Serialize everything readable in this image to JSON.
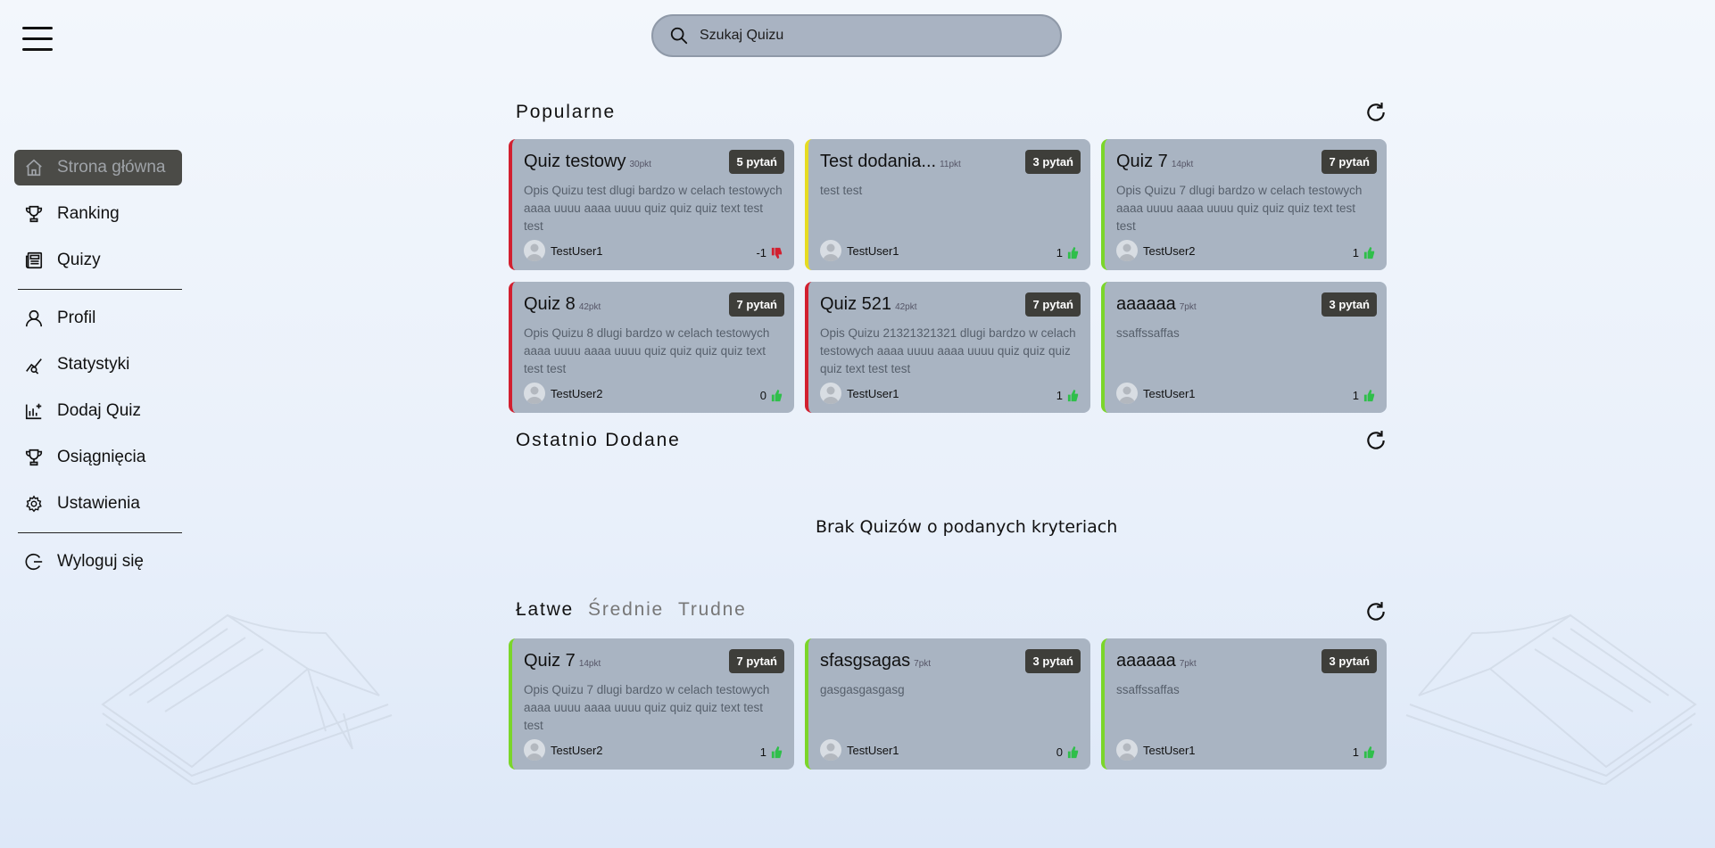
{
  "search": {
    "placeholder": "Szukaj Quizu"
  },
  "sidebar": {
    "items": [
      {
        "label": "Strona główna",
        "icon": "home-icon",
        "active": true
      },
      {
        "label": "Ranking",
        "icon": "trophy-icon"
      },
      {
        "label": "Quizy",
        "icon": "newspaper-icon"
      },
      {
        "label": "Profil",
        "icon": "user-icon"
      },
      {
        "label": "Statystyki",
        "icon": "chart-line-icon"
      },
      {
        "label": "Dodaj Quiz",
        "icon": "add-chart-icon"
      },
      {
        "label": "Osiągnięcia",
        "icon": "trophy-icon"
      },
      {
        "label": "Ustawienia",
        "icon": "gear-icon"
      },
      {
        "label": "Wyloguj się",
        "icon": "logout-icon"
      }
    ]
  },
  "sections": {
    "popular": {
      "title": "Popularne"
    },
    "recent": {
      "title": "Ostatnio Dodane",
      "empty": "Brak Quizów o podanych kryteriach"
    },
    "difficulty": {
      "tabs": [
        "Łatwe",
        "Średnie",
        "Trudne"
      ]
    }
  },
  "popular_cards": [
    {
      "title": "Quiz testowy",
      "pts": "30pkt",
      "badge": "5 pytań",
      "desc": "Opis Quizu test dlugi bardzo w celach testowych aaaa uuuu aaaa uuuu quiz quiz quiz text test test",
      "author": "TestUser1",
      "likes": "-1",
      "like_type": "down",
      "accent": "#d21f2f"
    },
    {
      "title": "Test dodania...",
      "pts": "11pkt",
      "badge": "3 pytań",
      "desc": "test test",
      "author": "TestUser1",
      "likes": "1",
      "like_type": "up",
      "accent": "#e6dc22"
    },
    {
      "title": "Quiz 7",
      "pts": "14pkt",
      "badge": "7 pytań",
      "desc": "Opis Quizu 7 dlugi bardzo w celach testowych aaaa uuuu aaaa uuuu quiz quiz quiz text test test",
      "author": "TestUser2",
      "likes": "1",
      "like_type": "up",
      "accent": "#7bd62a"
    },
    {
      "title": "Quiz 8",
      "pts": "42pkt",
      "badge": "7 pytań",
      "desc": "Opis Quizu 8 dlugi bardzo w celach testowych aaaa uuuu aaaa uuuu quiz quiz quiz quiz text test test",
      "author": "TestUser2",
      "likes": "0",
      "like_type": "up",
      "accent": "#d21f2f"
    },
    {
      "title": "Quiz 521",
      "pts": "42pkt",
      "badge": "7 pytań",
      "desc": "Opis Quizu 21321321321 dlugi bardzo w celach testowych aaaa uuuu aaaa uuuu quiz quiz quiz quiz text test test",
      "author": "TestUser1",
      "likes": "1",
      "like_type": "up",
      "accent": "#d21f2f"
    },
    {
      "title": "aaaaaa",
      "pts": "7pkt",
      "badge": "3 pytań",
      "desc": "ssaffssaffas",
      "author": "TestUser1",
      "likes": "1",
      "like_type": "up",
      "accent": "#7bd62a"
    }
  ],
  "easy_cards": [
    {
      "title": "Quiz 7",
      "pts": "14pkt",
      "badge": "7 pytań",
      "desc": "Opis Quizu 7 dlugi bardzo w celach testowych aaaa uuuu aaaa uuuu quiz quiz quiz text test test",
      "author": "TestUser2",
      "likes": "1",
      "like_type": "up",
      "accent": "#7bd62a"
    },
    {
      "title": "sfasgsagas",
      "pts": "7pkt",
      "badge": "3 pytań",
      "desc": "gasgasgasgasg",
      "author": "TestUser1",
      "likes": "0",
      "like_type": "up",
      "accent": "#7bd62a"
    },
    {
      "title": "aaaaaa",
      "pts": "7pkt",
      "badge": "3 pytań",
      "desc": "ssaffssaffas",
      "author": "TestUser1",
      "likes": "1",
      "like_type": "up",
      "accent": "#7bd62a"
    }
  ],
  "colors": {
    "like_up": "#2fbf4a",
    "like_down": "#d21f2f",
    "active_nav_bg": "#4b4b47",
    "card_bg": "#a9b4c2"
  }
}
